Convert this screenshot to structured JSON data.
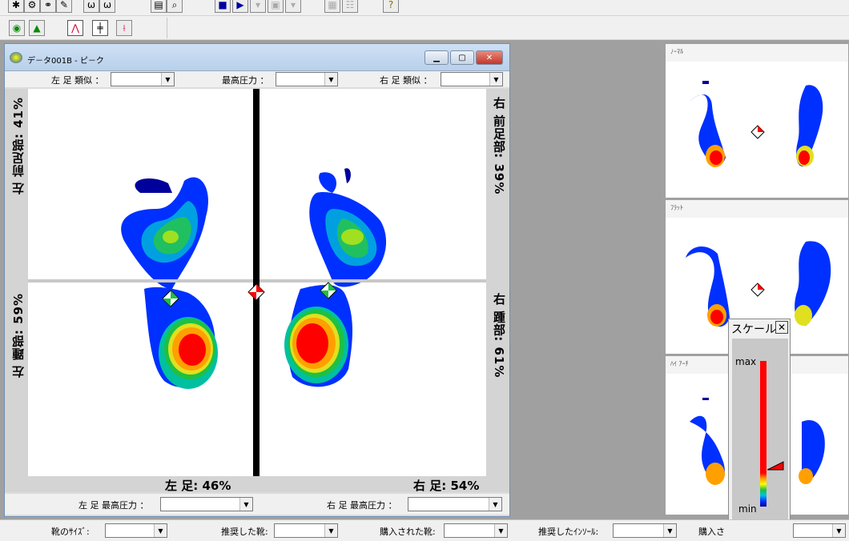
{
  "main_window": {
    "title": "デ－タ001B - ピ－ク",
    "left_similar_label": "左 足 類似 ：",
    "max_pressure_label": "最高圧力 ：",
    "right_similar_label": "右 足 類似 ：",
    "left_forefoot": "左 前足部: 41%",
    "left_heel": "左 踵部: 59%",
    "right_forefoot": "右 前足部: 39%",
    "right_heel": "右 踵部: 61%",
    "left_total": "左 足: 46%",
    "right_total": "右 足: 54%",
    "left_max_pressure_label": "左 足 最高圧力 ：",
    "right_max_pressure_label": "右 足 最高圧力 ："
  },
  "status_bar": {
    "shoe_size_label": "靴のｻｲｽﾞ:",
    "recommended_shoe_label": "推奨した靴:",
    "purchased_shoe_label": "購入された靴:",
    "recommended_insole_label": "推奨したｲﾝｿｰﾙ:",
    "purchased_label": "購入さ"
  },
  "side_panels": [
    {
      "title": "ﾉｰﾏﾙ"
    },
    {
      "title": "ﾌﾗｯﾄ"
    },
    {
      "title": "ﾊｲ ｱｰﾁ"
    }
  ],
  "scale_popup": {
    "title": "スケール",
    "max_label": "max",
    "min_label": "min"
  },
  "colors": {
    "window_border": "#6f8fb3",
    "heat_red": "#ff0000",
    "heat_blue": "#0000ff"
  }
}
